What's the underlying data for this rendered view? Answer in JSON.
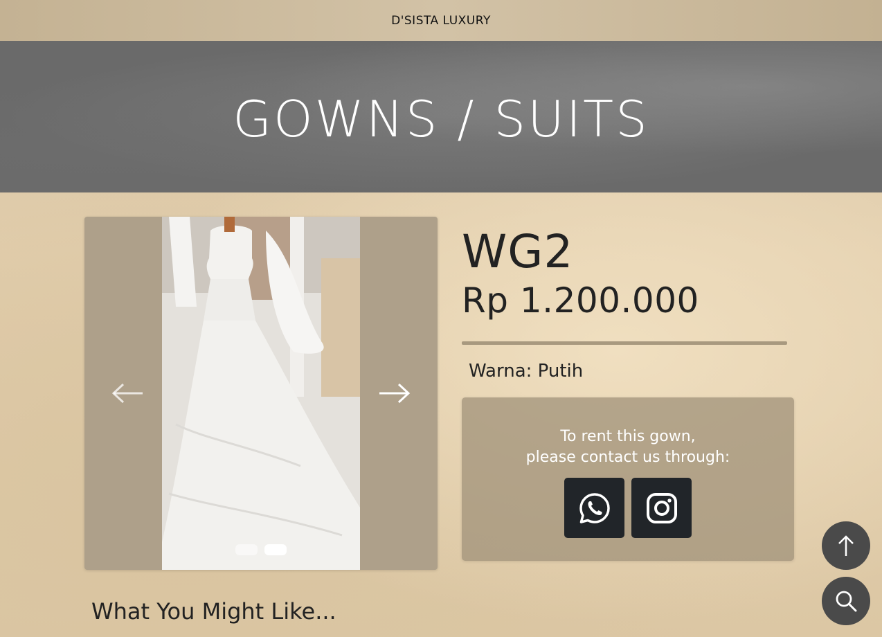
{
  "header": {
    "brand": "D'SISTA LUXURY"
  },
  "hero": {
    "title": "GOWNS / SUITS"
  },
  "product": {
    "code": "WG2",
    "price": "Rp 1.200.000",
    "color_text": "Warna: Putih"
  },
  "carousel": {
    "prev_icon": "arrow-left-icon",
    "next_icon": "arrow-right-icon",
    "slide_count": 2,
    "active_slide": 2
  },
  "contact": {
    "line1": "To rent this gown,",
    "line2": "please contact us through:",
    "buttons": [
      "whatsapp-icon",
      "instagram-icon"
    ]
  },
  "recommendations": {
    "title": "What You Might Like..."
  },
  "floating": {
    "top_icon": "arrow-up-icon",
    "search_icon": "search-icon"
  }
}
